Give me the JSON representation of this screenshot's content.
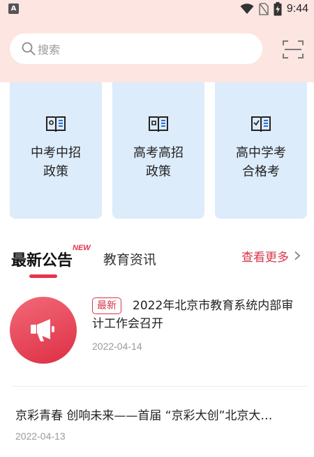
{
  "status_bar": {
    "app_icon_letter": "A",
    "time": "9:44",
    "icons": [
      "wifi-icon",
      "no-sim-icon",
      "battery-charging-icon"
    ]
  },
  "search": {
    "placeholder": "搜索",
    "icon": "search-icon",
    "scan_icon": "scan-icon"
  },
  "categories": [
    {
      "label": "中考中招政策",
      "line1": "中考中招",
      "line2": "政策",
      "icon": "book-icon"
    },
    {
      "label": "高考高招政策",
      "line1": "高考高招",
      "line2": "政策",
      "icon": "book-icon"
    },
    {
      "label": "高中学考合格考",
      "line1": "高中学考",
      "line2": "合格考",
      "icon": "book-check-icon"
    }
  ],
  "tabs": {
    "active": "最新公告",
    "active_badge": "NEW",
    "inactive": "教育资讯",
    "more_label": "查看更多"
  },
  "news": [
    {
      "badge": "最新",
      "title": "2022年北京市教育系统内部审计工作会召开",
      "date": "2022-04-14",
      "icon": "megaphone-icon"
    },
    {
      "title": "京彩青春 创响未来——首届 “京彩大创”北京大…",
      "date": "2022-04-13"
    }
  ],
  "colors": {
    "header_bg": "#fde5e1",
    "card_bg": "#dcecfb",
    "accent_red": "#e8344a",
    "text_primary": "#222222",
    "text_muted": "#999999"
  }
}
